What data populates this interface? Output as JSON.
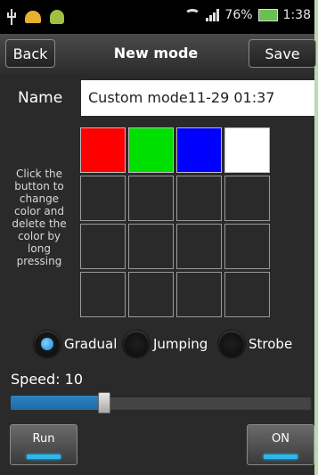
{
  "status_bar": {
    "battery_percent": "76%",
    "time": "1:38",
    "colors": {
      "battery": "#6ac050"
    }
  },
  "toolbar": {
    "back_label": "Back",
    "title": "New mode",
    "save_label": "Save"
  },
  "name_field": {
    "label": "Name",
    "value": "Custom mode11-29 01:37"
  },
  "color_grid": {
    "hint": "Click the button to change color and delete the color by long pressing",
    "cells": [
      "#ff0000",
      "#00e000",
      "#0000ff",
      "#ffffff",
      "",
      "",
      "",
      "",
      "",
      "",
      "",
      "",
      "",
      "",
      "",
      ""
    ]
  },
  "mode": {
    "options": [
      {
        "label": "Gradual",
        "selected": true
      },
      {
        "label": "Jumping",
        "selected": false
      },
      {
        "label": "Strobe",
        "selected": false
      }
    ]
  },
  "speed": {
    "label": "Speed: 10",
    "value": 10,
    "fraction": 0.31,
    "colors": {
      "fill": "#2d82c2"
    }
  },
  "buttons": {
    "run_label": "Run",
    "on_label": "ON",
    "indicator_color": "#2ab8f0"
  }
}
